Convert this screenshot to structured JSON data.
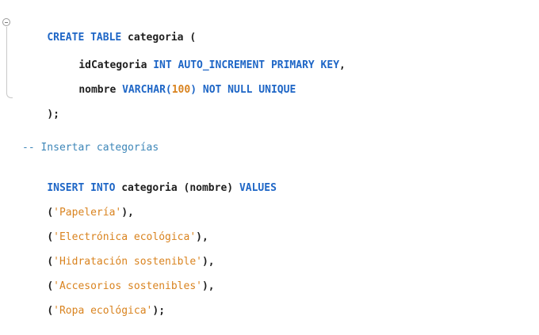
{
  "code": {
    "line1": {
      "kw1": "CREATE TABLE",
      "ident": " categoria (",
      "fold_state": "expanded"
    },
    "line2": {
      "ident": "idCategoria ",
      "kw1": "INT AUTO_INCREMENT PRIMARY KEY",
      "punct": ","
    },
    "line3": {
      "ident": "nombre ",
      "kw1": "VARCHAR(",
      "num": "100",
      "kw2": ") NOT NULL UNIQUE"
    },
    "line4": {
      "punct": ");"
    },
    "comment": "-- Insertar categorías",
    "insert": {
      "kw1": "INSERT INTO",
      "ident": " categoria (nombre) ",
      "kw2": "VALUES"
    },
    "rows": [
      {
        "open": "(",
        "value": "'Papelería'",
        "close": "),"
      },
      {
        "open": "(",
        "value": "'Electrónica ecológica'",
        "close": "),"
      },
      {
        "open": "(",
        "value": "'Hidratación sostenible'",
        "close": "),"
      },
      {
        "open": "(",
        "value": "'Accesorios sostenibles'",
        "close": "),"
      },
      {
        "open": "(",
        "value": "'Ropa ecológica'",
        "close": ");"
      }
    ]
  },
  "colors": {
    "keyword": "#1e66c6",
    "string": "#d9831f",
    "number": "#d9831f",
    "comment": "#3d86b8",
    "text": "#1f1f1f",
    "background": "#ffffff"
  },
  "icons": {
    "fold": "fold-collapse-icon"
  }
}
